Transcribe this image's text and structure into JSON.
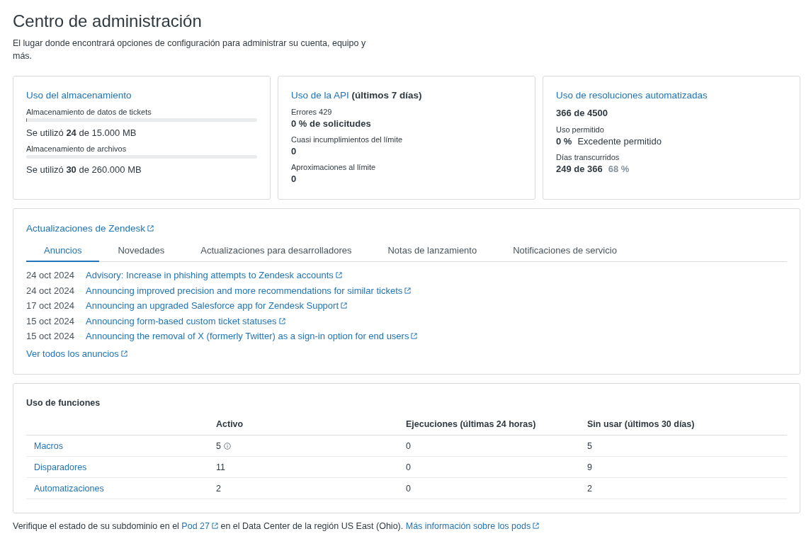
{
  "page": {
    "title": "Centro de administración",
    "subtitle": "El lugar donde encontrará opciones de configuración para administrar su cuenta, equipo y más."
  },
  "storage": {
    "title": "Uso del almacenamiento",
    "items": [
      {
        "label": "Almacenamiento de datos de tickets",
        "level": 0.0016,
        "used_prefix": "Se utilizó",
        "used": "24",
        "used_suffix": "de 15.000 MB"
      },
      {
        "label": "Almacenamiento de archivos",
        "level": 0.0001,
        "used_prefix": "Se utilizó",
        "used": "30",
        "used_suffix": "de 260.000 MB"
      }
    ]
  },
  "api": {
    "title": "Uso de la API",
    "title_suffix": "(últimos 7 días)",
    "items": [
      {
        "label": "Errores 429",
        "value": "0 % de solicitudes"
      },
      {
        "label": "Cuasi incumplimientos del límite",
        "value": "0"
      },
      {
        "label": "Aproximaciones al límite",
        "value": "0"
      }
    ]
  },
  "resolutions": {
    "title": "Uso de resoluciones automatizadas",
    "total": "366 de 4500",
    "allowed_label": "Uso permitido",
    "allowed_value": "0 %",
    "allowed_note": "Excedente permitido",
    "days_label": "Días transcurridos",
    "days_value": "249 de 366",
    "days_percent": "68 %"
  },
  "updates": {
    "title": "Actualizaciones de Zendesk",
    "tabs": [
      {
        "label": "Anuncios",
        "selected": true
      },
      {
        "label": "Novedades",
        "selected": false
      },
      {
        "label": "Actualizaciones para desarrolladores",
        "selected": false
      },
      {
        "label": "Notas de lanzamiento",
        "selected": false
      },
      {
        "label": "Notificaciones de servicio",
        "selected": false
      }
    ],
    "items": [
      {
        "date": "24 oct 2024",
        "title": "Advisory: Increase in phishing attempts to Zendesk accounts"
      },
      {
        "date": "24 oct 2024",
        "title": "Announcing improved precision and more recommendations for similar tickets"
      },
      {
        "date": "17 oct 2024",
        "title": "Announcing an upgraded Salesforce app for Zendesk Support"
      },
      {
        "date": "15 oct 2024",
        "title": "Announcing form-based custom ticket statuses"
      },
      {
        "date": "15 oct 2024",
        "title": "Announcing the removal of X (formerly Twitter) as a sign-in option for end users"
      }
    ],
    "view_all": "Ver todos los anuncios"
  },
  "features": {
    "title": "Uso de funciones",
    "columns": [
      "Activo",
      "Ejecuciones (últimas 24 horas)",
      "Sin usar (últimos 30 días)"
    ],
    "rows": [
      {
        "name": "Macros",
        "active": "5",
        "info": true,
        "runs": "0",
        "unused": "5"
      },
      {
        "name": "Disparadores",
        "active": "11",
        "info": false,
        "runs": "0",
        "unused": "9"
      },
      {
        "name": "Automatizaciones",
        "active": "2",
        "info": false,
        "runs": "0",
        "unused": "2"
      }
    ]
  },
  "footer": [
    {
      "kind": "text",
      "text": "Verifique el estado de su subdominio en el"
    },
    {
      "kind": "link",
      "text": "Pod 27"
    },
    {
      "kind": "text",
      "text": "en el Data Center de la región US East (Ohio)."
    },
    {
      "kind": "link",
      "text": "Más información sobre los pods"
    }
  ]
}
